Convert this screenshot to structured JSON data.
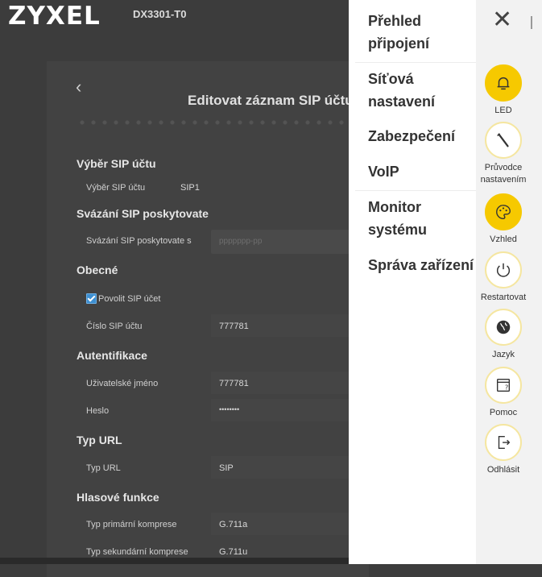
{
  "header": {
    "logo": "ZYXEL",
    "model": "DX3301-T0"
  },
  "page": {
    "title": "Editovat záznam SIP účtu",
    "sections": {
      "sip_account_selection": {
        "title": "Výběr SIP účtu",
        "label": "Výběr SIP účtu",
        "value": "SIP1"
      },
      "sip_provider_binding": {
        "title": "Svázání SIP poskytovate",
        "label": "Svázání SIP poskytovate s",
        "value": "ppppppp-pp"
      },
      "general": {
        "title": "Obecné",
        "enable_label": "Povolit SIP účet",
        "enable_checked": true,
        "number_label": "Číslo SIP účtu",
        "number_value": "777781"
      },
      "authentication": {
        "title": "Autentifikace",
        "username_label": "Uživatelské jméno",
        "username_value": "777781",
        "password_label": "Heslo",
        "password_value": "••••••••"
      },
      "url_type": {
        "title": "Typ URL",
        "label": "Typ URL",
        "value": "SIP"
      },
      "voice_features": {
        "title": "Hlasové funkce",
        "primary_codec_label": "Typ primární komprese",
        "primary_codec_value": "G.711a",
        "secondary_codec_label": "Typ sekundární komprese",
        "secondary_codec_value": "G.711u"
      }
    }
  },
  "menu": {
    "items": {
      "connection_overview": {
        "line1": "Přehled",
        "line2": "připojení"
      },
      "network_settings": {
        "line1": "Síťová",
        "line2": "nastavení"
      },
      "security": {
        "label": "Zabezpečení"
      },
      "voip": {
        "label": "VoIP"
      },
      "system_monitor": {
        "line1": "Monitor",
        "line2": "systému"
      },
      "maintenance": {
        "label": "Správa zařízení"
      }
    },
    "actions": {
      "led": {
        "label": "LED",
        "icon": "bell-icon"
      },
      "wizard": {
        "line1": "Průvodce",
        "line2": "nastavením",
        "icon": "wand-icon"
      },
      "theme": {
        "label": "Vzhled",
        "icon": "palette-icon"
      },
      "restart": {
        "label": "Restartovat",
        "icon": "power-icon"
      },
      "language": {
        "label": "Jazyk",
        "icon": "globe-icon"
      },
      "help": {
        "label": "Pomoc",
        "icon": "help-icon"
      },
      "logout": {
        "label": "Odhlásit",
        "icon": "logout-icon"
      }
    },
    "colors": {
      "accent": "#f6c900",
      "panel": "#ffffff",
      "side": "#f2f2f2"
    }
  }
}
